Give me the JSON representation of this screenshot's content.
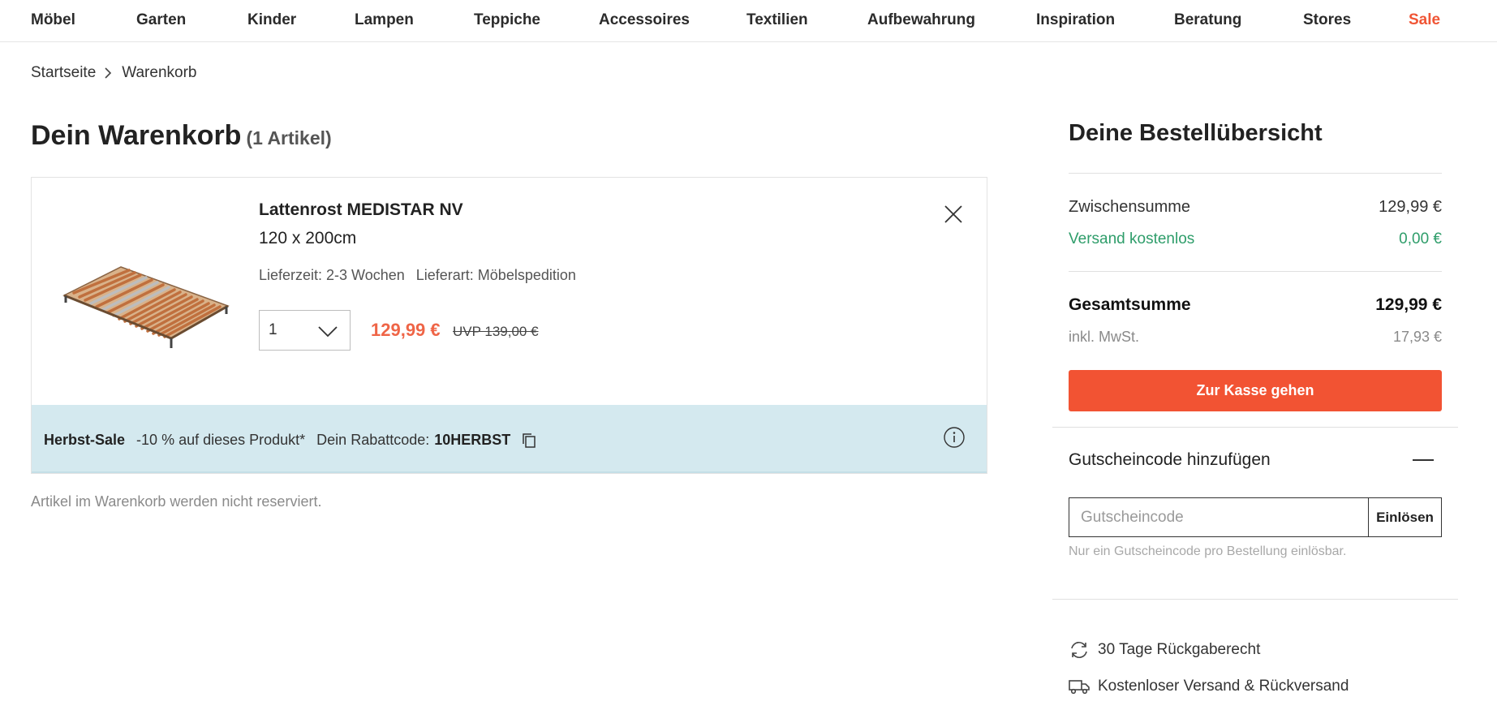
{
  "nav": {
    "items": [
      "Möbel",
      "Garten",
      "Kinder",
      "Lampen",
      "Teppiche",
      "Accessoires",
      "Textilien",
      "Aufbewahrung",
      "Inspiration",
      "Beratung",
      "Stores",
      "Sale"
    ]
  },
  "breadcrumb": {
    "home": "Startseite",
    "current": "Warenkorb"
  },
  "page": {
    "title": "Dein Warenkorb",
    "count": "(1 Artikel)"
  },
  "product": {
    "name": "Lattenrost MEDISTAR NV",
    "size": "120 x 200cm",
    "delivery_time": "Lieferzeit: 2-3 Wochen",
    "delivery_type": "Lieferart: Möbelspedition",
    "quantity": "1",
    "price": "129,99 €",
    "uvp": "UVP 139,00 €"
  },
  "promo": {
    "title": "Herbst-Sale",
    "discount": "-10 % auf dieses Produkt*",
    "code_label": "Dein Rabattcode:",
    "code": "10HERBST"
  },
  "reserve_note": "Artikel im Warenkorb werden nicht reserviert.",
  "summary": {
    "title": "Deine Bestellübersicht",
    "subtotal_label": "Zwischensumme",
    "subtotal_value": "129,99 €",
    "shipping_label": "Versand kostenlos",
    "shipping_value": "0,00 €",
    "total_label": "Gesamtsumme",
    "total_value": "129,99 €",
    "tax_label": "inkl. MwSt.",
    "tax_value": "17,93 €",
    "checkout_label": "Zur Kasse gehen"
  },
  "voucher": {
    "heading": "Gutscheincode hinzufügen",
    "placeholder": "Gutscheincode",
    "button": "Einlösen",
    "hint": "Nur ein Gutscheincode pro Bestellung einlösbar."
  },
  "usps": {
    "returns": "30 Tage Rückgaberecht",
    "shipping": "Kostenloser Versand & Rückversand"
  },
  "colors": {
    "accent": "#f25333",
    "sale": "#f05535",
    "price": "#ef6547",
    "success": "#2e9d6a",
    "promo_bg": "#d4e9ef"
  },
  "icons": [
    "chevron-right-icon",
    "close-icon",
    "chevron-down-icon",
    "copy-icon",
    "info-icon",
    "minus-icon",
    "return-icon",
    "truck-icon"
  ]
}
